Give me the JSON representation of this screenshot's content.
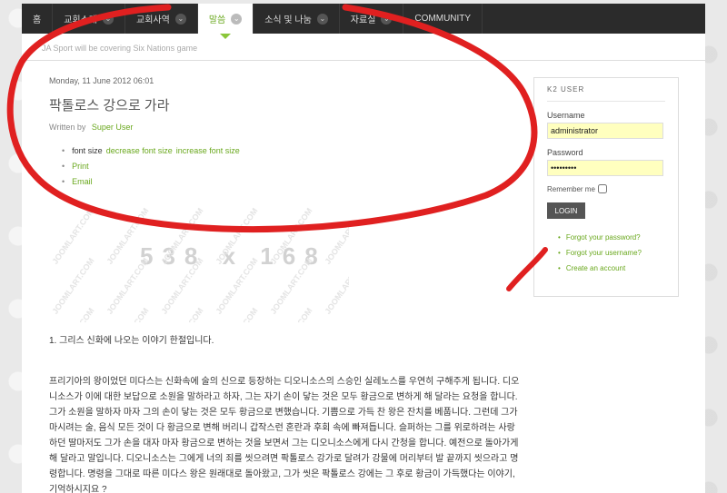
{
  "nav": {
    "items": [
      {
        "label": "홈",
        "has_chevron": false,
        "active": false
      },
      {
        "label": "교회소개",
        "has_chevron": true,
        "active": false
      },
      {
        "label": "교회사역",
        "has_chevron": true,
        "active": false
      },
      {
        "label": "말씀",
        "has_chevron": true,
        "active": true
      },
      {
        "label": "소식 및 나눔",
        "has_chevron": true,
        "active": false
      },
      {
        "label": "자료실",
        "has_chevron": true,
        "active": false
      },
      {
        "label": "COMMUNITY",
        "has_chevron": false,
        "active": false
      }
    ],
    "chevron_icon": "chevron-down-icon"
  },
  "ticker": {
    "text": "JA Sport will be covering Six Nations game"
  },
  "article": {
    "date": "Monday, 11 June 2012 06:01",
    "title": "팍톨로스 강으로 가라",
    "written_by_label": "Written by",
    "author": "Super User",
    "tools": {
      "font_size_label": "font size",
      "decrease": "decrease font size",
      "increase": "increase font size",
      "print": "Print",
      "email": "Email"
    },
    "placeholder": {
      "dimensions": "538 x 168",
      "watermark": "JOOMLART.COM"
    },
    "heading": "1.  그리스 신화에 나오는 이야기 한절입니다.",
    "body": " 프리기아의 왕이었던 미다스는 신화속에 술의 신으로 등장하는 디오니소스의 스승인 실레노스를 우연히 구해주게 됩니다. 디오니소스가 이에 대한 보답으로 소원을 말하라고 하자, 그는 자기 손이 닿는 것은 모두 황금으로 변하게 해 달라는 요청을 합니다. 그가 소원을 말하자 마자 그의 손이 닿는 것은 모두 황금으로 변했습니다. 기쁨으로 가득 찬 왕은 잔치를 베풉니다. 그런데 그가 마시려는 술, 음식 모든 것이 다 황금으로 변해 버리니 갑작스런 혼란과 후회 속에 빠져듭니다. 슬퍼하는 그를 위로하려는 사랑하던 딸마저도 그가 손을 대자 마자 황금으로 변하는 것을 보면서 그는 디오니소스에게 다시 간청을 합니다. 예전으로 돌아가게 해 달라고 말입니다. 디오니소스는 그에게 너의 죄를 씻으려면 팍톨로스 강가로 달려가 강물에 머리부터 발 끝까지 씻으라고 명령합니다. 명령을 그대로 따른 미다스 왕은 원래대로 돌아왔고, 그가 씻은 팍톨로스 강에는 그 후로 황금이 가득했다는 이야기, 기억하시지요 ?"
  },
  "k2": {
    "title": "K2 USER",
    "username_label": "Username",
    "username_value": "administrator",
    "password_label": "Password",
    "password_value": "•••••••••",
    "remember_label": "Remember me",
    "login_label": "LOGIN",
    "links": [
      "Forgot your password?",
      "Forgot your username?",
      "Create an account"
    ]
  },
  "colors": {
    "accent": "#6aa81e",
    "nav_bg": "#2b2b2b",
    "input_bg": "#ffffbf",
    "annotation_red": "#e02020"
  }
}
